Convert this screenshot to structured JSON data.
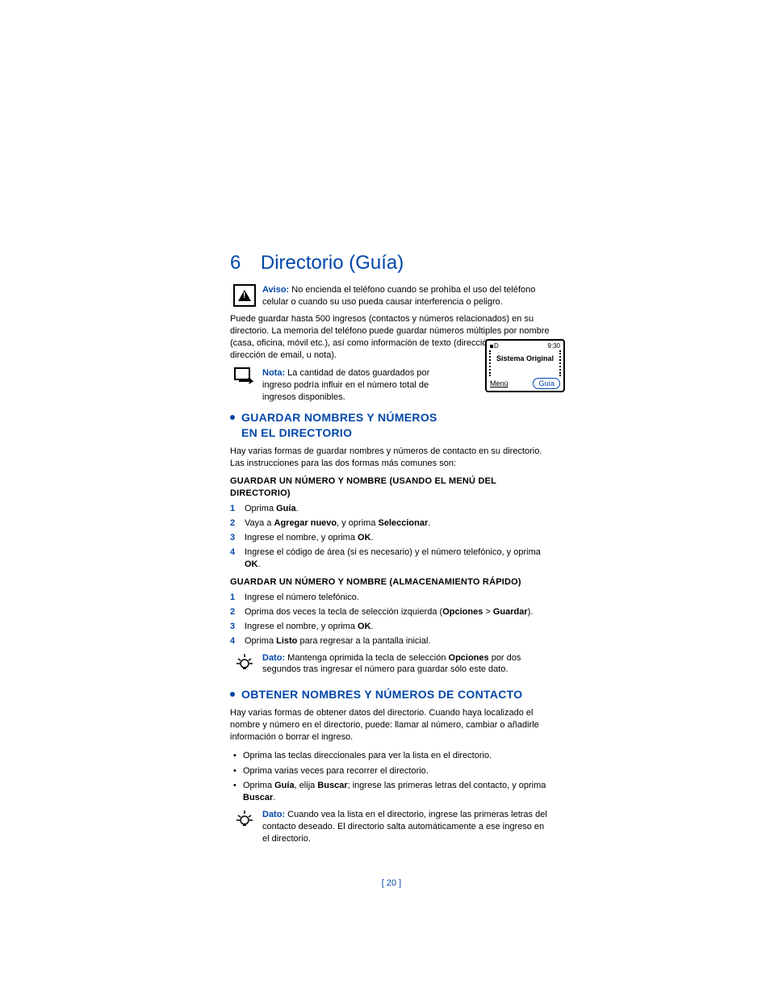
{
  "chapter": {
    "num": "6",
    "title": "Directorio (Guía)"
  },
  "aviso": {
    "label": "Aviso:",
    "text": "No encienda el teléfono cuando se prohíba el uso del teléfono celular o cuando su uso pueda causar interferencia o peligro."
  },
  "intro": "Puede guardar hasta 500 ingresos (contactos y números relacionados) en su directorio. La memoria del teléfono puede guardar números múltiples por nombre (casa, oficina, móvil etc.), así como información de texto (dirección postal, dirección de email, u nota).",
  "nota1": {
    "label": "Nota:",
    "text": "La cantidad de datos guardados por ingreso podría influir en el número total de ingresos disponibles."
  },
  "screen": {
    "sig": "D",
    "time": "9:30",
    "carrier": "Sistema Original",
    "left": "Menú",
    "right": "Guía"
  },
  "sec1": {
    "title": "GUARDAR NOMBRES Y NÚMEROS EN EL DIRECTORIO",
    "intro": "Hay varias formas de guardar nombres y números de contacto en su directorio. Las instrucciones para las dos formas más comunes son:",
    "sub1": {
      "title": "GUARDAR UN NÚMERO Y NOMBRE (USANDO EL MENÚ DEL DIRECTORIO)",
      "steps": [
        {
          "n": "1",
          "pre": "Oprima ",
          "b1": "Guía",
          "post": "."
        },
        {
          "n": "2",
          "pre": "Vaya a ",
          "b1": "Agregar nuevo",
          "mid": ", y oprima ",
          "b2": "Seleccionar",
          "post": "."
        },
        {
          "n": "3",
          "pre": "Ingrese el nombre, y oprima ",
          "b1": "OK",
          "post": "."
        },
        {
          "n": "4",
          "pre": "Ingrese el código de área (si es necesario) y el número telefónico, y oprima ",
          "b1": "OK",
          "post": "."
        }
      ]
    },
    "sub2": {
      "title": "GUARDAR UN NÚMERO Y NOMBRE (ALMACENAMIENTO RÁPIDO)",
      "steps": [
        {
          "n": "1",
          "pre": "Ingrese el número telefónico.",
          "b1": "",
          "post": ""
        },
        {
          "n": "2",
          "pre": "Oprima dos veces la tecla de selección izquierda (",
          "b1": "Opciones",
          "mid": " > ",
          "b2": "Guardar",
          "post": ")."
        },
        {
          "n": "3",
          "pre": "Ingrese el nombre, y oprima ",
          "b1": "OK",
          "post": "."
        },
        {
          "n": "4",
          "pre": "Oprima ",
          "b1": "Listo",
          "post": " para regresar a la pantalla inicial."
        }
      ]
    },
    "dato": {
      "label": "Dato:",
      "pre": "Mantenga oprimida la tecla de selección ",
      "b1": "Opciones",
      "post": " por dos segundos tras ingresar el número para guardar sólo este dato."
    }
  },
  "sec2": {
    "title": "OBTENER NOMBRES Y NÚMEROS DE CONTACTO",
    "intro": "Hay varias formas de obtener datos del directorio. Cuando haya localizado el nombre y número en el directorio, puede: llamar al número, cambiar o añadirle información o borrar el ingreso.",
    "bullets": [
      {
        "pre": "Oprima las teclas direccionales para ver la lista en el directorio."
      },
      {
        "pre": "Oprima varias veces para recorrer el directorio."
      },
      {
        "pre": "Oprima ",
        "b1": "Guía",
        "mid": ", elija ",
        "b2": "Buscar",
        "mid2": "; ingrese las primeras letras del contacto, y oprima ",
        "b3": "Buscar",
        "post": "."
      }
    ],
    "dato": {
      "label": "Dato:",
      "text": "Cuando vea la lista en el directorio, ingrese las primeras letras del contacto deseado. El directorio salta automáticamente a ese ingreso en el directorio."
    }
  },
  "pagenum": "[ 20 ]"
}
